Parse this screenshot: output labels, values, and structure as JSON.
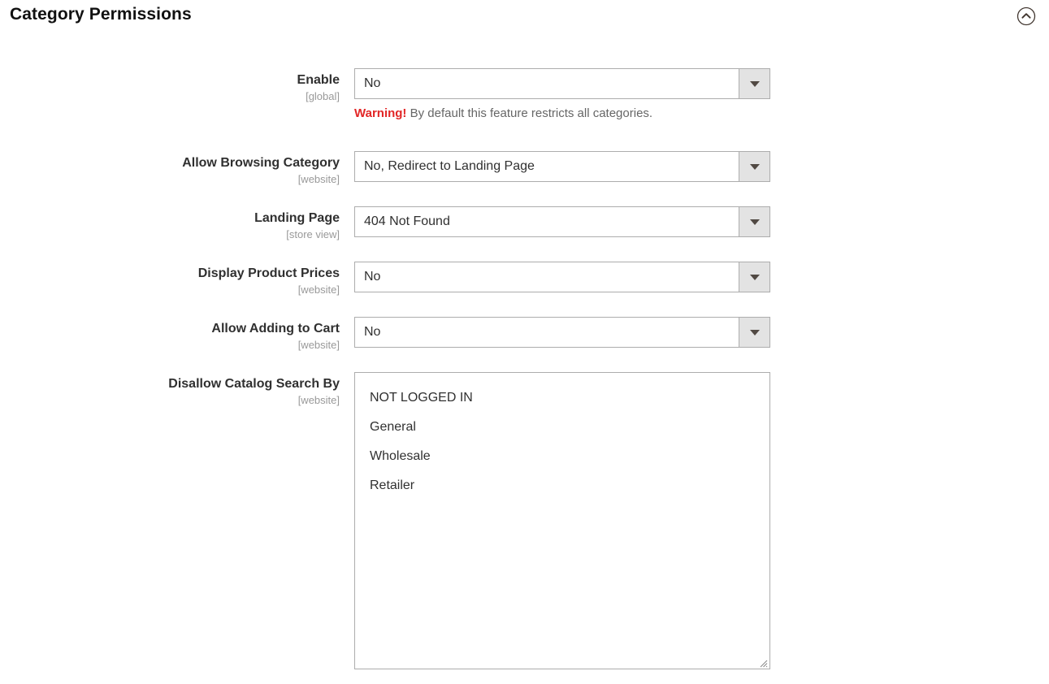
{
  "header": {
    "title": "Category Permissions",
    "collapse_icon": "chevron-up-circle-icon"
  },
  "form": {
    "fields": [
      {
        "id": "enable",
        "label": "Enable",
        "scope": "[global]",
        "type": "select",
        "value": "No",
        "note_strong": "Warning!",
        "note_text": " By default this feature restricts all categories."
      },
      {
        "id": "allow-browsing-category",
        "label": "Allow Browsing Category",
        "scope": "[website]",
        "type": "select",
        "value": "No, Redirect to Landing Page"
      },
      {
        "id": "landing-page",
        "label": "Landing Page",
        "scope": "[store view]",
        "type": "select",
        "value": "404 Not Found"
      },
      {
        "id": "display-product-prices",
        "label": "Display Product Prices",
        "scope": "[website]",
        "type": "select",
        "value": "No"
      },
      {
        "id": "allow-adding-to-cart",
        "label": "Allow Adding to Cart",
        "scope": "[website]",
        "type": "select",
        "value": "No"
      },
      {
        "id": "disallow-catalog-search-by",
        "label": "Disallow Catalog Search By",
        "scope": "[website]",
        "type": "multiselect",
        "options": [
          "NOT LOGGED IN",
          "General",
          "Wholesale",
          "Retailer"
        ]
      }
    ]
  },
  "colors": {
    "warning_red": "#e22626",
    "label_text": "#303030",
    "scope_text": "#999999",
    "border": "#adadad",
    "select_button_bg": "#e3e3e3",
    "page_bg": "#ffffff"
  }
}
